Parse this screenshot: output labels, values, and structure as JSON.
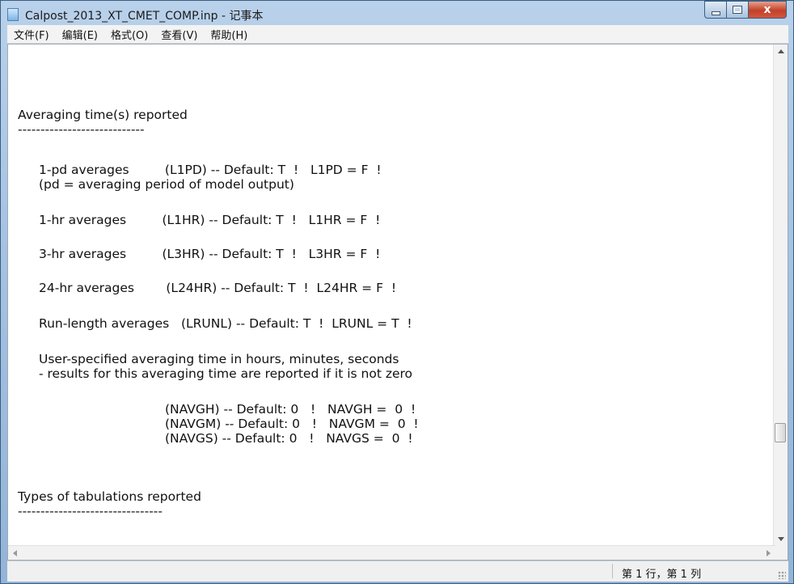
{
  "window": {
    "title": "Calpost_2013_XT_CMET_COMP.inp - 记事本",
    "controls": {
      "minimize_icon": "minimize-icon",
      "maximize_icon": "maximize-icon",
      "close_label": "x"
    }
  },
  "menu": [
    "文件(F)",
    "编辑(E)",
    "格式(O)",
    "查看(V)",
    "帮助(H)"
  ],
  "document": {
    "lines": [
      "Averaging time(s) reported",
      "----------------------------",
      "1-pd averages         (L1PD) -- Default: T  !   L1PD = F  !",
      "(pd = averaging period of model output)",
      "1-hr averages         (L1HR) -- Default: T  !   L1HR = F  !",
      "3-hr averages         (L3HR) -- Default: T  !   L3HR = F  !",
      "24-hr averages        (L24HR) -- Default: T  !  L24HR = F  !",
      "Run-length averages   (LRUNL) -- Default: T  !  LRUNL = T  !",
      "User-specified averaging time in hours, minutes, seconds",
      "- results for this averaging time are reported if it is not zero",
      "(NAVGH) -- Default: 0   !   NAVGH =  0  !",
      "(NAVGM) -- Default: 0   !   NAVGM =  0  !",
      "(NAVGS) -- Default: 0   !   NAVGS =  0  !",
      "Types of tabulations reported",
      "--------------------------------"
    ]
  },
  "status": {
    "position": "第 1 行，第 1 列"
  }
}
